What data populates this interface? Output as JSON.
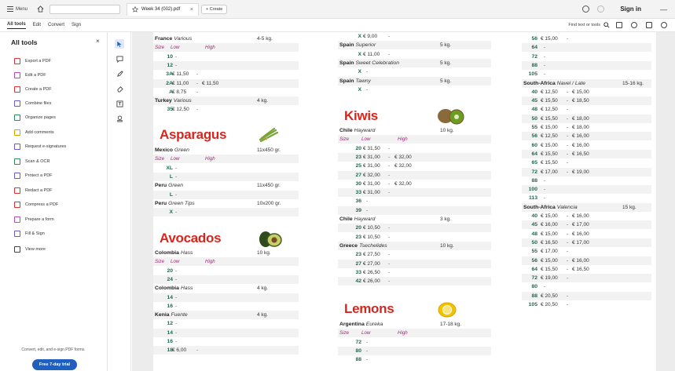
{
  "topbar": {
    "menu_label": "Menu",
    "tab_title": "Week 34 (002).pdf",
    "create_label": "Create",
    "signin_label": "Sign in"
  },
  "menubar": {
    "items": [
      "All tools",
      "Edit",
      "Convert",
      "Sign"
    ],
    "find_label": "Find text or tools"
  },
  "panel": {
    "title": "All tools",
    "tools": [
      {
        "label": "Export a PDF",
        "color": "#d33"
      },
      {
        "label": "Edit a PDF",
        "color": "#c04bb4"
      },
      {
        "label": "Create a PDF",
        "color": "#d33"
      },
      {
        "label": "Combine files",
        "color": "#6a5acd"
      },
      {
        "label": "Organize pages",
        "color": "#2e8b57"
      },
      {
        "label": "Add comments",
        "color": "#e0a100"
      },
      {
        "label": "Request e-signatures",
        "color": "#6a5acd"
      },
      {
        "label": "Scan & OCR",
        "color": "#2e8b57"
      },
      {
        "label": "Protect a PDF",
        "color": "#6a5acd"
      },
      {
        "label": "Redact a PDF",
        "color": "#d33"
      },
      {
        "label": "Compress a PDF",
        "color": "#d33"
      },
      {
        "label": "Prepare a form",
        "color": "#c04bb4"
      },
      {
        "label": "Fill & Sign",
        "color": "#6a5acd"
      },
      {
        "label": "View more",
        "color": "#444"
      }
    ],
    "footer_text": "Convert, edit, and e-sign PDF forms.",
    "trial_label": "Free 7-day trial"
  },
  "document": {
    "col1": {
      "top_rows": [
        {
          "type": "origin",
          "country": "France",
          "variety": "Various",
          "pack": "4-5 kg."
        },
        {
          "type": "header",
          "size": "Size",
          "low": "Low",
          "high": "High"
        },
        {
          "type": "price",
          "size": "10",
          "low": "",
          "high": ""
        },
        {
          "type": "price",
          "size": "12",
          "low": "",
          "high": ""
        },
        {
          "type": "price",
          "size": "3A",
          "low": "€ 11,50",
          "high": ""
        },
        {
          "type": "price",
          "size": "2A",
          "low": "€ 11,00",
          "high": "€ 11,50"
        },
        {
          "type": "price",
          "size": "A",
          "low": "€ 8,75",
          "high": ""
        },
        {
          "type": "origin",
          "country": "Turkey",
          "variety": "Various",
          "pack": "4 kg."
        },
        {
          "type": "price",
          "size": "35",
          "low": "€ 12,50",
          "high": ""
        }
      ],
      "asparagus_title": "Asparagus",
      "asparagus_rows": [
        {
          "type": "origin",
          "country": "Mexico",
          "variety": "Green",
          "pack": "11x450 gr."
        },
        {
          "type": "header",
          "size": "Size",
          "low": "Low",
          "high": "High"
        },
        {
          "type": "price",
          "size": "XL",
          "low": "",
          "high": ""
        },
        {
          "type": "price",
          "size": "L",
          "low": "",
          "high": ""
        },
        {
          "type": "origin",
          "country": "Peru",
          "variety": "Green",
          "pack": "11x450 gr."
        },
        {
          "type": "price",
          "size": "L",
          "low": "",
          "high": ""
        },
        {
          "type": "origin",
          "country": "Peru",
          "variety": "Green Tips",
          "pack": "10x200 gr."
        },
        {
          "type": "price",
          "size": "X",
          "low": "",
          "high": ""
        }
      ],
      "avocados_title": "Avocados",
      "avocados_rows": [
        {
          "type": "origin",
          "country": "Colombia",
          "variety": "Hass",
          "pack": "10 kg."
        },
        {
          "type": "header",
          "size": "Size",
          "low": "Low",
          "high": "High"
        },
        {
          "type": "price",
          "size": "20",
          "low": "",
          "high": ""
        },
        {
          "type": "price",
          "size": "24",
          "low": "",
          "high": ""
        },
        {
          "type": "origin",
          "country": "Colombia",
          "variety": "Hass",
          "pack": "4 kg."
        },
        {
          "type": "price",
          "size": "14",
          "low": "",
          "high": ""
        },
        {
          "type": "price",
          "size": "16",
          "low": "",
          "high": ""
        },
        {
          "type": "origin",
          "country": "Kenia",
          "variety": "Fuente",
          "pack": "4 kg."
        },
        {
          "type": "price",
          "size": "12",
          "low": "",
          "high": ""
        },
        {
          "type": "price",
          "size": "14",
          "low": "",
          "high": ""
        },
        {
          "type": "price",
          "size": "16",
          "low": "",
          "high": ""
        },
        {
          "type": "price",
          "size": "18",
          "low": "€ 6,00",
          "high": ""
        }
      ]
    },
    "col2": {
      "top_rows": [
        {
          "type": "price",
          "size": "X",
          "low": "€ 9,00",
          "high": ""
        },
        {
          "type": "origin",
          "country": "Spain",
          "variety": "Superior",
          "pack": "5 kg."
        },
        {
          "type": "price",
          "size": "X",
          "low": "€ 11,00",
          "high": ""
        },
        {
          "type": "origin",
          "country": "Spain",
          "variety": "Sweet Celebration",
          "pack": "5 kg."
        },
        {
          "type": "price",
          "size": "X",
          "low": "",
          "high": ""
        },
        {
          "type": "origin",
          "country": "Spain",
          "variety": "Tawny",
          "pack": "5 kg."
        },
        {
          "type": "price",
          "size": "X",
          "low": "",
          "high": ""
        }
      ],
      "kiwis_title": "Kiwis",
      "kiwis_rows": [
        {
          "type": "origin",
          "country": "Chile",
          "variety": "Hayward",
          "pack": "10 kg."
        },
        {
          "type": "header",
          "size": "Size",
          "low": "Low",
          "high": "High"
        },
        {
          "type": "price",
          "size": "20",
          "low": "€ 31,50",
          "high": ""
        },
        {
          "type": "price",
          "size": "23",
          "low": "€ 31,00",
          "high": "€ 32,00"
        },
        {
          "type": "price",
          "size": "25",
          "low": "€ 31,00",
          "high": "€ 32,00"
        },
        {
          "type": "price",
          "size": "27",
          "low": "€ 32,00",
          "high": ""
        },
        {
          "type": "price",
          "size": "30",
          "low": "€ 31,00",
          "high": "€ 32,00"
        },
        {
          "type": "price",
          "size": "33",
          "low": "€ 31,00",
          "high": ""
        },
        {
          "type": "price",
          "size": "36",
          "low": "",
          "high": ""
        },
        {
          "type": "price",
          "size": "39",
          "low": "",
          "high": ""
        },
        {
          "type": "origin",
          "country": "Chile",
          "variety": "Hayward",
          "pack": "3 kg."
        },
        {
          "type": "price",
          "size": "20",
          "low": "€ 10,50",
          "high": ""
        },
        {
          "type": "price",
          "size": "23",
          "low": "€ 10,50",
          "high": ""
        },
        {
          "type": "origin",
          "country": "Greece",
          "variety": "Tsechelides",
          "pack": "10 kg."
        },
        {
          "type": "price",
          "size": "23",
          "low": "€ 27,50",
          "high": ""
        },
        {
          "type": "price",
          "size": "27",
          "low": "€ 27,00",
          "high": ""
        },
        {
          "type": "price",
          "size": "33",
          "low": "€ 26,50",
          "high": ""
        },
        {
          "type": "price",
          "size": "42",
          "low": "€ 26,00",
          "high": ""
        }
      ],
      "lemons_title": "Lemons",
      "lemons_rows": [
        {
          "type": "origin",
          "country": "Argentina",
          "variety": "Eureka",
          "pack": "17-18 kg."
        },
        {
          "type": "header",
          "size": "Size",
          "low": "Low",
          "high": "High"
        },
        {
          "type": "price",
          "size": "72",
          "low": "",
          "high": ""
        },
        {
          "type": "price",
          "size": "80",
          "low": "",
          "high": ""
        },
        {
          "type": "price",
          "size": "88",
          "low": "",
          "high": ""
        }
      ]
    },
    "col3": {
      "rows": [
        {
          "type": "price",
          "size": "56",
          "low": "€ 15,00",
          "high": ""
        },
        {
          "type": "price",
          "size": "64",
          "low": "",
          "high": ""
        },
        {
          "type": "price",
          "size": "72",
          "low": "",
          "high": ""
        },
        {
          "type": "price",
          "size": "88",
          "low": "",
          "high": ""
        },
        {
          "type": "price",
          "size": "105",
          "low": "",
          "high": ""
        },
        {
          "type": "origin",
          "country": "South-Africa",
          "variety": "Navel / Late",
          "pack": "15-16 kg."
        },
        {
          "type": "price",
          "size": "40",
          "low": "€ 12,50",
          "high": "€ 15,00"
        },
        {
          "type": "price",
          "size": "45",
          "low": "€ 15,50",
          "high": "€ 18,50"
        },
        {
          "type": "price",
          "size": "48",
          "low": "€ 12,50",
          "high": ""
        },
        {
          "type": "price",
          "size": "50",
          "low": "€ 15,50",
          "high": "€ 18,00"
        },
        {
          "type": "price",
          "size": "55",
          "low": "€ 15,00",
          "high": "€ 18,00"
        },
        {
          "type": "price",
          "size": "56",
          "low": "€ 12,50",
          "high": "€ 16,00"
        },
        {
          "type": "price",
          "size": "60",
          "low": "€ 15,00",
          "high": "€ 16,00"
        },
        {
          "type": "price",
          "size": "64",
          "low": "€ 15,50",
          "high": "€ 16,50"
        },
        {
          "type": "price",
          "size": "65",
          "low": "€ 15,50",
          "high": ""
        },
        {
          "type": "price",
          "size": "72",
          "low": "€ 17,00",
          "high": "€ 19,00"
        },
        {
          "type": "price",
          "size": "88",
          "low": "",
          "high": ""
        },
        {
          "type": "price",
          "size": "100",
          "low": "",
          "high": ""
        },
        {
          "type": "price",
          "size": "113",
          "low": "",
          "high": ""
        },
        {
          "type": "origin",
          "country": "South-Africa",
          "variety": "Valencia",
          "pack": "15 kg."
        },
        {
          "type": "price",
          "size": "40",
          "low": "€ 15,00",
          "high": "€ 16,00"
        },
        {
          "type": "price",
          "size": "45",
          "low": "€ 16,00",
          "high": "€ 17,00"
        },
        {
          "type": "price",
          "size": "48",
          "low": "€ 15,00",
          "high": "€ 16,00"
        },
        {
          "type": "price",
          "size": "50",
          "low": "€ 16,50",
          "high": "€ 17,00"
        },
        {
          "type": "price",
          "size": "55",
          "low": "€ 17,00",
          "high": ""
        },
        {
          "type": "price",
          "size": "56",
          "low": "€ 15,00",
          "high": "€ 16,00"
        },
        {
          "type": "price",
          "size": "64",
          "low": "€ 15,50",
          "high": "€ 16,50"
        },
        {
          "type": "price",
          "size": "72",
          "low": "€ 19,00",
          "high": ""
        },
        {
          "type": "price",
          "size": "80",
          "low": "",
          "high": ""
        },
        {
          "type": "price",
          "size": "88",
          "low": "€ 20,50",
          "high": ""
        },
        {
          "type": "price",
          "size": "105",
          "low": "€ 20,50",
          "high": ""
        }
      ]
    }
  }
}
